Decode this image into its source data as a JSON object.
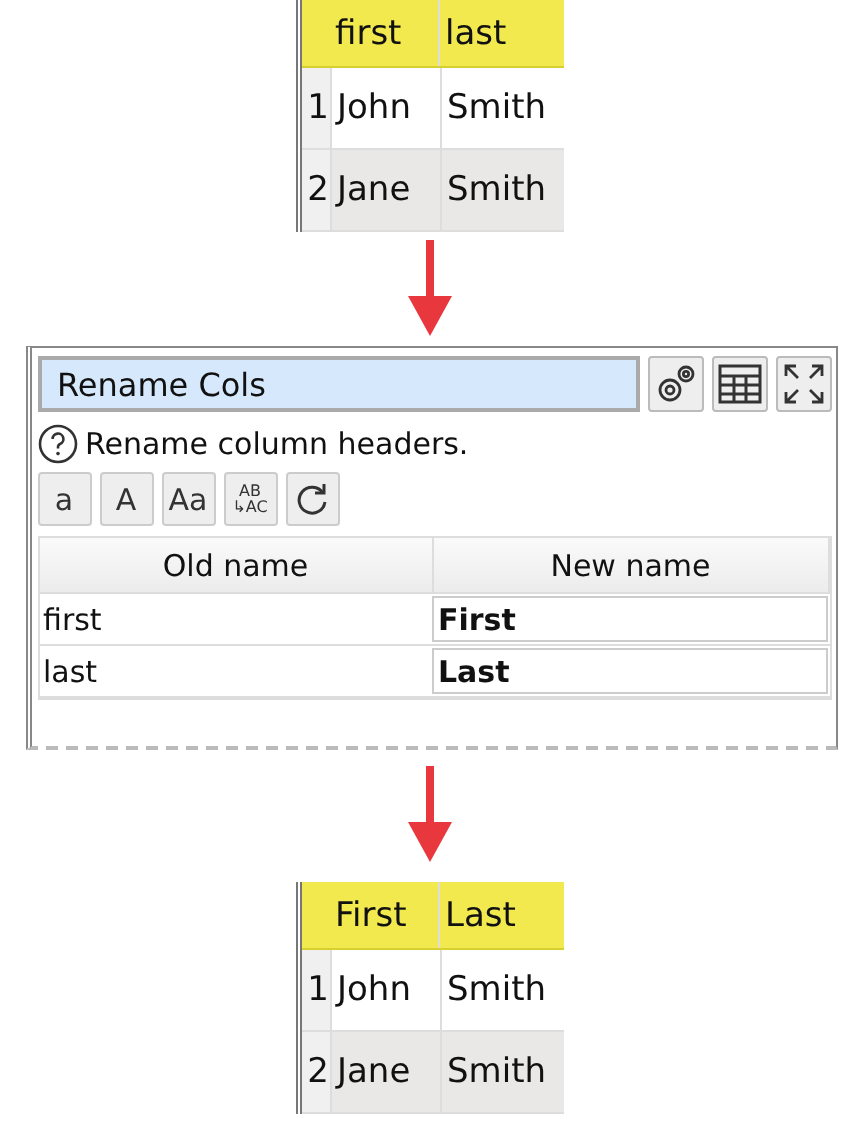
{
  "input_table": {
    "columns": [
      "first",
      "last"
    ],
    "rows": [
      {
        "index": "1",
        "cells": [
          "John",
          "Smith"
        ]
      },
      {
        "index": "2",
        "cells": [
          "Jane",
          "Smith"
        ]
      }
    ]
  },
  "panel": {
    "title": "Rename Cols",
    "help": "Rename column headers.",
    "tool_buttons": [
      {
        "kind": "text",
        "label": "a"
      },
      {
        "kind": "text",
        "label": "A"
      },
      {
        "kind": "text",
        "label": "Aa"
      },
      {
        "kind": "replace",
        "top": "AB",
        "bottom": "↳AC"
      },
      {
        "kind": "reset"
      }
    ],
    "columns": [
      "Old name",
      "New name"
    ],
    "rows": [
      {
        "old": "first",
        "new": "First"
      },
      {
        "old": "last",
        "new": "Last"
      }
    ]
  },
  "output_table": {
    "columns": [
      "First",
      "Last"
    ],
    "rows": [
      {
        "index": "1",
        "cells": [
          "John",
          "Smith"
        ]
      },
      {
        "index": "2",
        "cells": [
          "Jane",
          "Smith"
        ]
      }
    ]
  }
}
